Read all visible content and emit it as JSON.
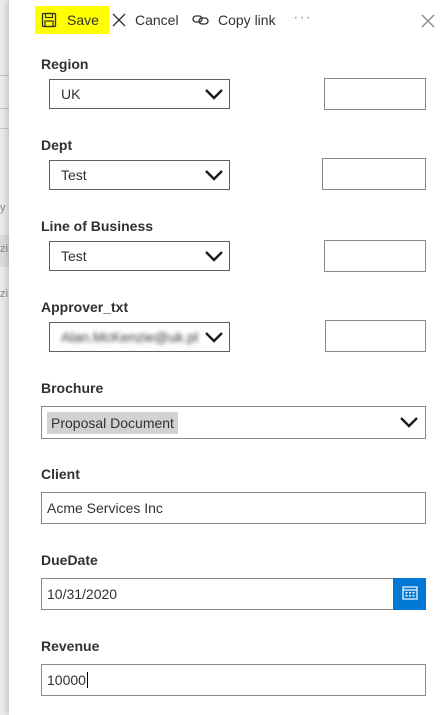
{
  "backdrop": {
    "chars": [
      "y",
      "zi",
      "zi"
    ]
  },
  "toolbar": {
    "save_label": "Save",
    "cancel_label": "Cancel",
    "copy_link_label": "Copy link",
    "more_label": "···"
  },
  "form": {
    "region": {
      "label": "Region",
      "value": "UK"
    },
    "dept": {
      "label": "Dept",
      "value": "Test"
    },
    "line_of_business": {
      "label": "Line of Business",
      "value": "Test"
    },
    "approver": {
      "label": "Approver_txt",
      "value": "Alan.McKenzie@uk.pl"
    },
    "brochure": {
      "label": "Brochure",
      "value": "Proposal Document"
    },
    "client": {
      "label": "Client",
      "value": "Acme Services Inc"
    },
    "due_date": {
      "label": "DueDate",
      "value": "10/31/2020"
    },
    "revenue": {
      "label": "Revenue",
      "value": "10000"
    }
  },
  "colors": {
    "accent": "#0078d4",
    "highlight": "#ffff00",
    "chip": "#d2d2d2"
  },
  "icons": {
    "save": "save-icon",
    "cancel": "close-icon",
    "copy_link": "link-icon",
    "close": "close-icon",
    "dropdown": "chevron-down-icon",
    "calendar": "calendar-icon"
  }
}
